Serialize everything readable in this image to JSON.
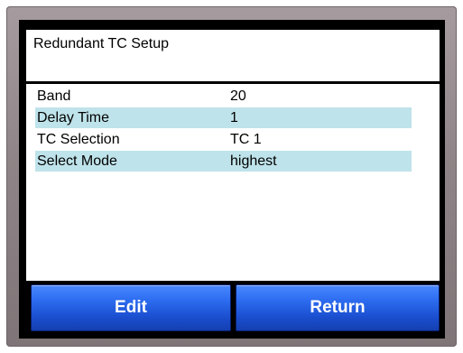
{
  "header": {
    "title": "Redundant TC Setup"
  },
  "settings": [
    {
      "label": "Band",
      "value": "20",
      "highlight": false
    },
    {
      "label": "Delay Time",
      "value": "1",
      "highlight": true
    },
    {
      "label": "TC Selection",
      "value": "TC 1",
      "highlight": false
    },
    {
      "label": "Select Mode",
      "value": "highest",
      "highlight": true
    }
  ],
  "buttons": {
    "edit_label": "Edit",
    "return_label": "Return"
  },
  "colors": {
    "row_highlight": "#bfe3ea",
    "button_blue": "#2f6ff2",
    "bezel": "#8f8487"
  }
}
